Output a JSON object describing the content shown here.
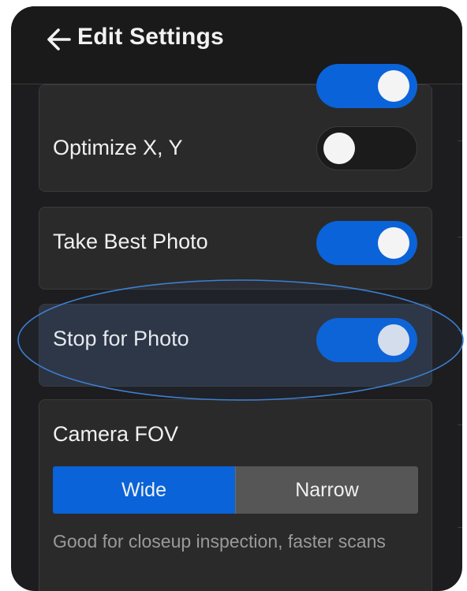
{
  "header": {
    "title": "Edit Settings"
  },
  "settings": {
    "optimize_xy": {
      "label": "Optimize X, Y",
      "state": "off"
    },
    "take_best_photo": {
      "label": "Take Best Photo",
      "state": "on"
    },
    "stop_for_photo": {
      "label": "Stop for Photo",
      "state": "on"
    }
  },
  "camera_fov": {
    "label": "Camera FOV",
    "options": [
      "Wide",
      "Narrow"
    ],
    "selected": "Wide",
    "hint": "Good for closeup inspection, faster scans"
  },
  "colors": {
    "accent": "#0a63d8",
    "background": "#1d1d1f",
    "card": "#2a2a2b",
    "highlight_ring": "#3d7fd0"
  },
  "icons": {
    "back": "arrow-left-icon"
  }
}
